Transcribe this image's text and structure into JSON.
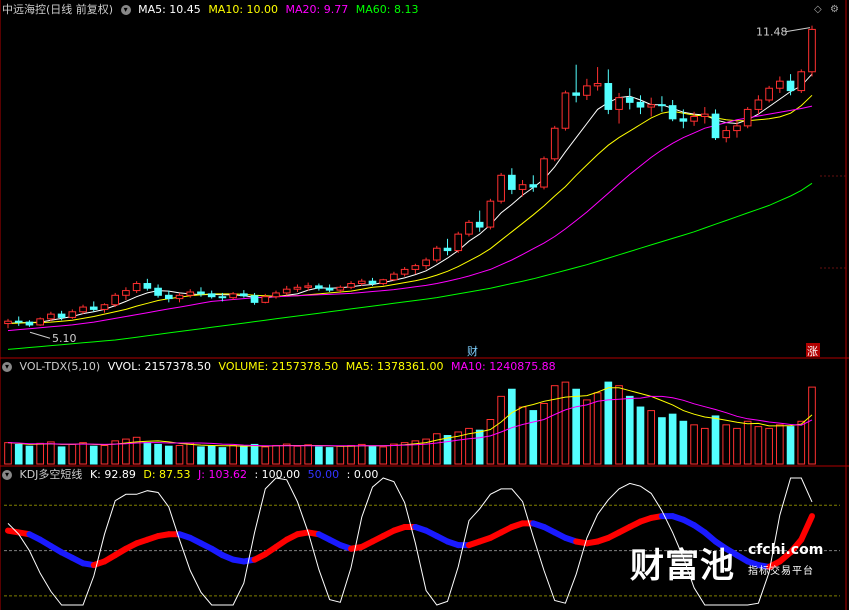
{
  "main_panel": {
    "title": "中远海控(日线 前复权)",
    "ma_labels": [
      {
        "text": "MA5: 10.45",
        "color": "#ffffff"
      },
      {
        "text": "MA10: 10.00",
        "color": "#ffff00"
      },
      {
        "text": "MA20: 9.77",
        "color": "#ff00ff"
      },
      {
        "text": "MA60: 8.13",
        "color": "#00ff00"
      }
    ],
    "high_marker": "11.48",
    "low_marker": "5.10",
    "marker_cai": "财",
    "marker_zhang": "涨"
  },
  "vol_panel": {
    "labels": [
      {
        "text": "VOL-TDX(5,10)",
        "color": "#cccccc"
      },
      {
        "text": "VVOL: 2157378.50",
        "color": "#ffffff"
      },
      {
        "text": "VOLUME: 2157378.50",
        "color": "#ffff00"
      },
      {
        "text": "MA5: 1378361.00",
        "color": "#ffff00"
      },
      {
        "text": "MA10: 1240875.88",
        "color": "#ff00ff"
      }
    ]
  },
  "kdj_panel": {
    "labels": [
      {
        "text": "KDJ多空短线",
        "color": "#cccccc"
      },
      {
        "text": "K: 92.89",
        "color": "#ffffff"
      },
      {
        "text": "D: 87.53",
        "color": "#ffff00"
      },
      {
        "text": "J: 103.62",
        "color": "#ff00ff"
      },
      {
        "text": ": 100.00",
        "color": "#ffffff"
      },
      {
        "text": "50.00",
        "color": "#3333ff"
      },
      {
        "text": ": 0.00",
        "color": "#ffffff"
      }
    ]
  },
  "watermark": {
    "big": "财富池",
    "domain": "cfchi.com",
    "sub": "指标交易平台"
  },
  "colors": {
    "up": "#ff3030",
    "down": "#54ffff",
    "ma5": "#ffffff",
    "ma10": "#ffff00",
    "ma20": "#ff00ff",
    "ma60": "#00ff00",
    "kdj_bull": "#ff0000",
    "kdj_bear": "#1a1aff",
    "border": "#b00000"
  },
  "chart_data": {
    "type": "candlestick",
    "y_range_price": [
      4.8,
      11.6
    ],
    "candles": [
      [
        5.15,
        5.25,
        5.05,
        5.2
      ],
      [
        5.2,
        5.3,
        5.1,
        5.18
      ],
      [
        5.18,
        5.22,
        5.08,
        5.12
      ],
      [
        5.12,
        5.28,
        5.1,
        5.25
      ],
      [
        5.25,
        5.4,
        5.2,
        5.35
      ],
      [
        5.35,
        5.42,
        5.22,
        5.28
      ],
      [
        5.28,
        5.45,
        5.25,
        5.4
      ],
      [
        5.4,
        5.55,
        5.35,
        5.5
      ],
      [
        5.5,
        5.62,
        5.4,
        5.45
      ],
      [
        5.45,
        5.58,
        5.38,
        5.55
      ],
      [
        5.55,
        5.8,
        5.5,
        5.75
      ],
      [
        5.75,
        5.92,
        5.65,
        5.85
      ],
      [
        5.85,
        6.05,
        5.8,
        6.0
      ],
      [
        6.0,
        6.1,
        5.85,
        5.9
      ],
      [
        5.9,
        5.98,
        5.7,
        5.75
      ],
      [
        5.75,
        5.85,
        5.6,
        5.68
      ],
      [
        5.68,
        5.8,
        5.6,
        5.75
      ],
      [
        5.75,
        5.88,
        5.7,
        5.82
      ],
      [
        5.82,
        5.92,
        5.72,
        5.78
      ],
      [
        5.78,
        5.85,
        5.68,
        5.72
      ],
      [
        5.72,
        5.8,
        5.62,
        5.7
      ],
      [
        5.7,
        5.82,
        5.65,
        5.78
      ],
      [
        5.78,
        5.86,
        5.7,
        5.74
      ],
      [
        5.74,
        5.8,
        5.55,
        5.6
      ],
      [
        5.6,
        5.78,
        5.58,
        5.72
      ],
      [
        5.72,
        5.85,
        5.68,
        5.8
      ],
      [
        5.8,
        5.95,
        5.75,
        5.88
      ],
      [
        5.88,
        5.98,
        5.82,
        5.92
      ],
      [
        5.92,
        6.02,
        5.85,
        5.95
      ],
      [
        5.95,
        6.0,
        5.85,
        5.9
      ],
      [
        5.9,
        5.98,
        5.82,
        5.86
      ],
      [
        5.86,
        5.96,
        5.8,
        5.92
      ],
      [
        5.92,
        6.05,
        5.88,
        6.0
      ],
      [
        6.0,
        6.1,
        5.95,
        6.05
      ],
      [
        6.05,
        6.12,
        5.95,
        6.0
      ],
      [
        6.0,
        6.1,
        5.96,
        6.08
      ],
      [
        6.08,
        6.25,
        6.05,
        6.2
      ],
      [
        6.2,
        6.35,
        6.15,
        6.3
      ],
      [
        6.3,
        6.42,
        6.2,
        6.38
      ],
      [
        6.38,
        6.55,
        6.3,
        6.5
      ],
      [
        6.5,
        6.8,
        6.45,
        6.75
      ],
      [
        6.75,
        6.95,
        6.6,
        6.7
      ],
      [
        6.7,
        7.1,
        6.65,
        7.05
      ],
      [
        7.05,
        7.35,
        7.0,
        7.3
      ],
      [
        7.3,
        7.55,
        7.1,
        7.2
      ],
      [
        7.2,
        7.8,
        7.15,
        7.75
      ],
      [
        7.75,
        8.35,
        7.7,
        8.3
      ],
      [
        8.3,
        8.45,
        7.9,
        8.0
      ],
      [
        8.0,
        8.2,
        7.85,
        8.1
      ],
      [
        8.1,
        8.3,
        7.95,
        8.05
      ],
      [
        8.05,
        8.7,
        8.0,
        8.65
      ],
      [
        8.65,
        9.35,
        8.6,
        9.3
      ],
      [
        9.3,
        10.1,
        9.25,
        10.05
      ],
      [
        10.05,
        10.65,
        9.85,
        10.0
      ],
      [
        10.0,
        10.35,
        9.9,
        10.2
      ],
      [
        10.2,
        10.6,
        10.1,
        10.25
      ],
      [
        10.25,
        10.55,
        9.6,
        9.7
      ],
      [
        9.7,
        10.05,
        9.4,
        9.95
      ],
      [
        9.95,
        10.15,
        9.7,
        9.85
      ],
      [
        9.85,
        10.0,
        9.6,
        9.75
      ],
      [
        9.75,
        9.95,
        9.55,
        9.8
      ],
      [
        9.8,
        9.98,
        9.65,
        9.78
      ],
      [
        9.78,
        9.9,
        9.45,
        9.5
      ],
      [
        9.5,
        9.7,
        9.3,
        9.45
      ],
      [
        9.45,
        9.65,
        9.35,
        9.55
      ],
      [
        9.55,
        9.75,
        9.4,
        9.6
      ],
      [
        9.6,
        9.7,
        9.05,
        9.1
      ],
      [
        9.1,
        9.35,
        9.0,
        9.25
      ],
      [
        9.25,
        9.45,
        9.1,
        9.35
      ],
      [
        9.35,
        9.75,
        9.3,
        9.7
      ],
      [
        9.7,
        10.0,
        9.6,
        9.9
      ],
      [
        9.9,
        10.2,
        9.85,
        10.15
      ],
      [
        10.15,
        10.4,
        10.05,
        10.3
      ],
      [
        10.3,
        10.45,
        10.0,
        10.1
      ],
      [
        10.1,
        10.55,
        10.05,
        10.5
      ],
      [
        10.5,
        11.48,
        10.4,
        11.4
      ]
    ],
    "ma_series": {
      "MA5": [
        5.15,
        5.17,
        5.17,
        5.18,
        5.22,
        5.26,
        5.3,
        5.36,
        5.4,
        5.45,
        5.53,
        5.62,
        5.72,
        5.8,
        5.85,
        5.84,
        5.8,
        5.78,
        5.76,
        5.77,
        5.76,
        5.76,
        5.74,
        5.71,
        5.7,
        5.72,
        5.75,
        5.78,
        5.86,
        5.91,
        5.9,
        5.91,
        5.93,
        5.96,
        5.98,
        6.02,
        6.07,
        6.12,
        6.19,
        6.27,
        6.4,
        6.54,
        6.7,
        6.9,
        7.05,
        7.25,
        7.5,
        7.68,
        7.88,
        8.04,
        8.22,
        8.48,
        8.8,
        9.1,
        9.4,
        9.7,
        9.85,
        9.95,
        9.98,
        9.9,
        9.8,
        9.8,
        9.72,
        9.64,
        9.6,
        9.58,
        9.48,
        9.42,
        9.4,
        9.48,
        9.6,
        9.76,
        9.92,
        10.08,
        10.2,
        10.45
      ],
      "MA10": [
        5.15,
        5.16,
        5.17,
        5.17,
        5.18,
        5.2,
        5.22,
        5.26,
        5.3,
        5.35,
        5.4,
        5.45,
        5.52,
        5.58,
        5.64,
        5.68,
        5.71,
        5.74,
        5.76,
        5.78,
        5.78,
        5.78,
        5.77,
        5.75,
        5.74,
        5.73,
        5.74,
        5.74,
        5.76,
        5.78,
        5.8,
        5.82,
        5.84,
        5.88,
        5.92,
        5.94,
        5.98,
        6.02,
        6.06,
        6.11,
        6.18,
        6.26,
        6.36,
        6.48,
        6.6,
        6.74,
        6.92,
        7.1,
        7.28,
        7.46,
        7.65,
        7.86,
        8.06,
        8.3,
        8.52,
        8.74,
        8.94,
        9.1,
        9.24,
        9.38,
        9.52,
        9.62,
        9.66,
        9.62,
        9.58,
        9.56,
        9.52,
        9.48,
        9.46,
        9.46,
        9.48,
        9.5,
        9.54,
        9.62,
        9.78,
        10.0
      ],
      "MA20": [
        5.0,
        5.02,
        5.04,
        5.06,
        5.08,
        5.1,
        5.12,
        5.15,
        5.18,
        5.22,
        5.26,
        5.3,
        5.34,
        5.38,
        5.42,
        5.46,
        5.5,
        5.54,
        5.58,
        5.62,
        5.64,
        5.66,
        5.68,
        5.7,
        5.71,
        5.72,
        5.73,
        5.74,
        5.75,
        5.76,
        5.77,
        5.78,
        5.79,
        5.81,
        5.83,
        5.85,
        5.87,
        5.9,
        5.93,
        5.96,
        6.0,
        6.05,
        6.1,
        6.16,
        6.23,
        6.3,
        6.4,
        6.5,
        6.62,
        6.74,
        6.86,
        7.0,
        7.16,
        7.34,
        7.52,
        7.72,
        7.92,
        8.12,
        8.32,
        8.5,
        8.68,
        8.84,
        8.98,
        9.1,
        9.2,
        9.3,
        9.36,
        9.42,
        9.48,
        9.52,
        9.56,
        9.6,
        9.64,
        9.68,
        9.72,
        9.77
      ],
      "MA60": [
        4.6,
        4.62,
        4.64,
        4.66,
        4.68,
        4.7,
        4.72,
        4.74,
        4.76,
        4.78,
        4.8,
        4.83,
        4.86,
        4.89,
        4.92,
        4.95,
        4.98,
        5.01,
        5.04,
        5.07,
        5.1,
        5.13,
        5.16,
        5.19,
        5.22,
        5.25,
        5.28,
        5.31,
        5.34,
        5.37,
        5.4,
        5.43,
        5.46,
        5.49,
        5.52,
        5.55,
        5.58,
        5.61,
        5.64,
        5.67,
        5.7,
        5.74,
        5.78,
        5.82,
        5.86,
        5.9,
        5.95,
        6.0,
        6.05,
        6.1,
        6.16,
        6.22,
        6.28,
        6.34,
        6.4,
        6.47,
        6.54,
        6.61,
        6.68,
        6.75,
        6.82,
        6.89,
        6.96,
        7.03,
        7.1,
        7.18,
        7.26,
        7.34,
        7.42,
        7.5,
        7.58,
        7.66,
        7.76,
        7.86,
        7.98,
        8.13
      ]
    },
    "volume": [
      0.6,
      0.55,
      0.5,
      0.58,
      0.62,
      0.48,
      0.55,
      0.6,
      0.5,
      0.52,
      0.65,
      0.7,
      0.75,
      0.6,
      0.55,
      0.5,
      0.52,
      0.58,
      0.48,
      0.5,
      0.46,
      0.52,
      0.5,
      0.55,
      0.48,
      0.52,
      0.56,
      0.5,
      0.54,
      0.48,
      0.46,
      0.5,
      0.52,
      0.55,
      0.5,
      0.48,
      0.56,
      0.6,
      0.65,
      0.7,
      0.85,
      0.8,
      0.9,
      1.0,
      0.95,
      1.25,
      1.9,
      2.1,
      1.6,
      1.5,
      1.7,
      2.2,
      2.3,
      2.1,
      1.8,
      2.0,
      2.3,
      2.2,
      1.9,
      1.6,
      1.5,
      1.3,
      1.4,
      1.2,
      1.1,
      1.0,
      1.35,
      1.1,
      1.0,
      1.2,
      1.05,
      1.0,
      1.1,
      1.05,
      1.2,
      2.16
    ],
    "volume_unit": "millions",
    "vol_range": [
      0,
      2.5
    ],
    "vol_ma5": [
      0.6,
      0.58,
      0.55,
      0.56,
      0.57,
      0.55,
      0.55,
      0.57,
      0.55,
      0.54,
      0.56,
      0.59,
      0.62,
      0.64,
      0.65,
      0.62,
      0.58,
      0.55,
      0.53,
      0.52,
      0.51,
      0.51,
      0.5,
      0.51,
      0.5,
      0.51,
      0.52,
      0.52,
      0.52,
      0.52,
      0.51,
      0.5,
      0.5,
      0.51,
      0.51,
      0.51,
      0.52,
      0.54,
      0.57,
      0.6,
      0.67,
      0.73,
      0.78,
      0.85,
      0.9,
      0.97,
      1.18,
      1.44,
      1.6,
      1.67,
      1.76,
      1.82,
      1.88,
      1.9,
      1.92,
      2.02,
      2.14,
      2.14,
      2.06,
      1.98,
      1.9,
      1.78,
      1.66,
      1.5,
      1.4,
      1.32,
      1.28,
      1.23,
      1.17,
      1.13,
      1.14,
      1.07,
      1.07,
      1.08,
      1.12,
      1.38
    ],
    "vol_ma10": [
      0.6,
      0.59,
      0.57,
      0.57,
      0.57,
      0.56,
      0.56,
      0.56,
      0.56,
      0.55,
      0.56,
      0.57,
      0.59,
      0.6,
      0.6,
      0.59,
      0.59,
      0.59,
      0.59,
      0.58,
      0.56,
      0.55,
      0.53,
      0.52,
      0.51,
      0.51,
      0.51,
      0.51,
      0.51,
      0.51,
      0.51,
      0.51,
      0.51,
      0.51,
      0.51,
      0.51,
      0.52,
      0.53,
      0.54,
      0.56,
      0.59,
      0.63,
      0.67,
      0.71,
      0.74,
      0.79,
      0.9,
      1.02,
      1.11,
      1.18,
      1.25,
      1.39,
      1.52,
      1.61,
      1.66,
      1.76,
      1.8,
      1.82,
      1.84,
      1.85,
      1.9,
      1.9,
      1.86,
      1.79,
      1.69,
      1.61,
      1.53,
      1.44,
      1.34,
      1.27,
      1.23,
      1.18,
      1.15,
      1.11,
      1.09,
      1.24
    ],
    "kdj_k": [
      75,
      70,
      62,
      50,
      38,
      28,
      22,
      20,
      30,
      48,
      65,
      72,
      76,
      80,
      82,
      78,
      66,
      52,
      40,
      30,
      20,
      18,
      30,
      50,
      70,
      82,
      84,
      80,
      70,
      55,
      40,
      35,
      45,
      65,
      80,
      88,
      90,
      85,
      70,
      50,
      40,
      38,
      48,
      65,
      72,
      80,
      86,
      90,
      88,
      75,
      60,
      45,
      40,
      48,
      60,
      70,
      78,
      86,
      92,
      95,
      95,
      90,
      82,
      70,
      55,
      42,
      30,
      22,
      18,
      15,
      20,
      30,
      55,
      80,
      88,
      92
    ],
    "kdj_d": [
      72,
      70,
      68,
      62,
      55,
      48,
      42,
      36,
      34,
      38,
      45,
      52,
      58,
      62,
      66,
      68,
      68,
      64,
      58,
      52,
      45,
      40,
      38,
      40,
      46,
      54,
      62,
      68,
      70,
      68,
      62,
      56,
      52,
      54,
      60,
      66,
      72,
      76,
      76,
      72,
      66,
      60,
      56,
      56,
      60,
      64,
      70,
      76,
      80,
      80,
      76,
      70,
      64,
      60,
      58,
      60,
      64,
      70,
      76,
      82,
      86,
      88,
      88,
      84,
      78,
      70,
      60,
      52,
      45,
      38,
      34,
      32,
      38,
      48,
      62,
      88
    ],
    "kdj_j": [
      80,
      68,
      50,
      25,
      5,
      -10,
      -18,
      -12,
      22,
      68,
      105,
      112,
      112,
      116,
      114,
      98,
      62,
      28,
      4,
      -14,
      -30,
      -26,
      14,
      70,
      118,
      138,
      128,
      104,
      70,
      29,
      -4,
      -7,
      31,
      87,
      120,
      132,
      126,
      103,
      58,
      6,
      -12,
      -6,
      32,
      83,
      96,
      112,
      118,
      118,
      104,
      65,
      28,
      -5,
      -8,
      24,
      64,
      90,
      106,
      118,
      124,
      121,
      113,
      94,
      70,
      42,
      9,
      -14,
      -30,
      -38,
      -36,
      -31,
      -8,
      26,
      89,
      144,
      140,
      103.62
    ],
    "kdj_range": [
      -10,
      130
    ],
    "kdj_levels": [
      100,
      50,
      0
    ],
    "kdj_trend": [
      1,
      1,
      0,
      0,
      0,
      0,
      0,
      0,
      1,
      1,
      1,
      1,
      1,
      1,
      1,
      1,
      0,
      0,
      0,
      0,
      0,
      0,
      0,
      1,
      1,
      1,
      1,
      1,
      1,
      0,
      0,
      0,
      1,
      1,
      1,
      1,
      1,
      1,
      0,
      0,
      0,
      0,
      0,
      1,
      1,
      1,
      1,
      1,
      1,
      0,
      0,
      0,
      0,
      1,
      1,
      1,
      1,
      1,
      1,
      1,
      1,
      0,
      0,
      0,
      0,
      0,
      0,
      0,
      0,
      0,
      0,
      1,
      1,
      1,
      1,
      1
    ]
  }
}
